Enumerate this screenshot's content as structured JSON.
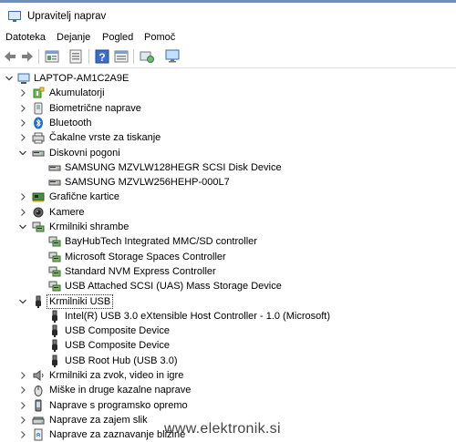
{
  "window": {
    "title": "Upravitelj naprav"
  },
  "menu": [
    "Datoteka",
    "Dejanje",
    "Pogled",
    "Pomoč"
  ],
  "toolbar": {
    "buttons": [
      "back-arrow-icon",
      "forward-arrow-icon",
      "properties-icon",
      "update-driver-icon",
      "help-icon",
      "view-icon",
      "scan-hardware-icon",
      "monitor-icon"
    ]
  },
  "tree": {
    "root": "LAPTOP-AM1C2A9E",
    "items": [
      {
        "label": "Akumulatorji",
        "icon": "battery-icon",
        "level": 1,
        "expanded": false
      },
      {
        "label": "Biometrične naprave",
        "icon": "biometric-icon",
        "level": 1,
        "expanded": false
      },
      {
        "label": "Bluetooth",
        "icon": "bluetooth-icon",
        "level": 1,
        "expanded": false
      },
      {
        "label": "Čakalne vrste za tiskanje",
        "icon": "printer-icon",
        "level": 1,
        "expanded": false
      },
      {
        "label": "Diskovni pogoni",
        "icon": "disk-drive-icon",
        "level": 1,
        "expanded": true
      },
      {
        "label": "SAMSUNG MZVLW128HEGR SCSI Disk Device",
        "icon": "disk-drive-icon",
        "level": 2
      },
      {
        "label": "SAMSUNG MZVLW256HEHP-000L7",
        "icon": "disk-drive-icon",
        "level": 2
      },
      {
        "label": "Grafične kartice",
        "icon": "display-adapter-icon",
        "level": 1,
        "expanded": false
      },
      {
        "label": "Kamere",
        "icon": "camera-icon",
        "level": 1,
        "expanded": false
      },
      {
        "label": "Krmilniki shrambe",
        "icon": "storage-controller-icon",
        "level": 1,
        "expanded": true
      },
      {
        "label": "BayHubTech Integrated MMC/SD controller",
        "icon": "storage-controller-icon",
        "level": 2
      },
      {
        "label": "Microsoft Storage Spaces Controller",
        "icon": "storage-controller-icon",
        "level": 2
      },
      {
        "label": "Standard NVM Express Controller",
        "icon": "storage-controller-icon",
        "level": 2
      },
      {
        "label": "USB Attached SCSI (UAS) Mass Storage Device",
        "icon": "storage-controller-icon",
        "level": 2
      },
      {
        "label": "Krmilniki USB",
        "icon": "usb-icon",
        "level": 1,
        "expanded": true,
        "selected": true
      },
      {
        "label": "Intel(R) USB 3.0 eXtensible Host Controller - 1.0 (Microsoft)",
        "icon": "usb-icon",
        "level": 2
      },
      {
        "label": "USB Composite Device",
        "icon": "usb-icon",
        "level": 2
      },
      {
        "label": "USB Composite Device",
        "icon": "usb-icon",
        "level": 2
      },
      {
        "label": "USB Root Hub (USB 3.0)",
        "icon": "usb-icon",
        "level": 2
      },
      {
        "label": "Krmilniki za zvok, video in igre",
        "icon": "speaker-icon",
        "level": 1,
        "expanded": false
      },
      {
        "label": "Miške in druge kazalne naprave",
        "icon": "mouse-icon",
        "level": 1,
        "expanded": false
      },
      {
        "label": "Naprave s programsko opremo",
        "icon": "software-device-icon",
        "level": 1,
        "expanded": false
      },
      {
        "label": "Naprave za zajem slik",
        "icon": "scanner-icon",
        "level": 1,
        "expanded": false
      },
      {
        "label": "Naprave za zaznavanje bližine",
        "icon": "proximity-icon",
        "level": 1,
        "expanded": false
      }
    ]
  },
  "watermark": "www.elektronik.si"
}
